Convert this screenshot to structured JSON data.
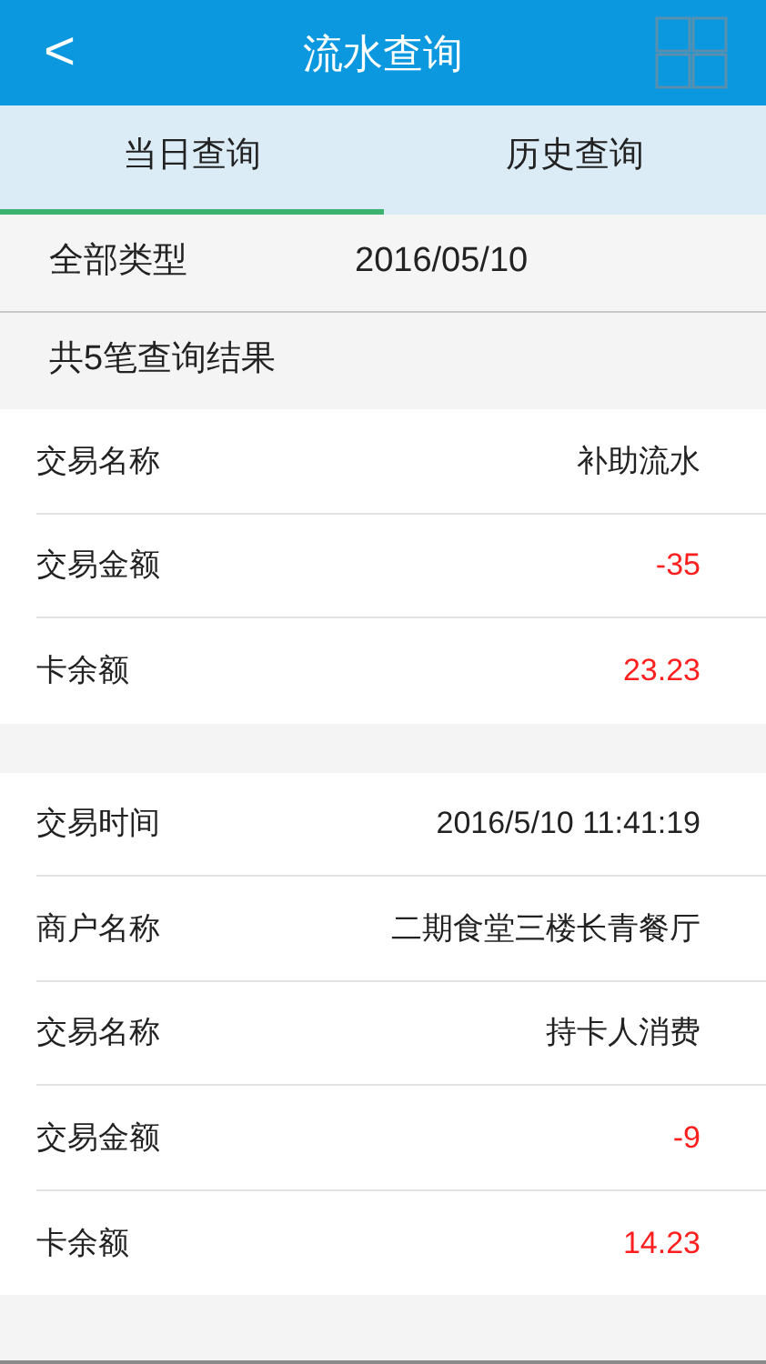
{
  "header": {
    "title": "流水查询",
    "back": "<"
  },
  "tabs": [
    {
      "label": "当日查询",
      "selected": true
    },
    {
      "label": "历史查询",
      "selected": false
    }
  ],
  "filter": {
    "type": "全部类型",
    "date": "2016/05/10"
  },
  "result_count": "共5笔查询结果",
  "records": [
    {
      "rows": [
        {
          "label": "交易名称",
          "value": "补助流水",
          "kind": "text"
        },
        {
          "label": "交易金额",
          "value": "-35",
          "kind": "amount"
        },
        {
          "label": "卡余额",
          "value": "23.23",
          "kind": "amount"
        }
      ]
    },
    {
      "rows": [
        {
          "label": "交易时间",
          "value": "2016/5/10 11:41:19",
          "kind": "text"
        },
        {
          "label": "商户名称",
          "value": "二期食堂三楼长青餐厅",
          "kind": "text"
        },
        {
          "label": "交易名称",
          "value": "持卡人消费",
          "kind": "text"
        },
        {
          "label": "交易金额",
          "value": "-9",
          "kind": "amount"
        },
        {
          "label": "卡余额",
          "value": "14.23",
          "kind": "amount"
        }
      ]
    }
  ]
}
